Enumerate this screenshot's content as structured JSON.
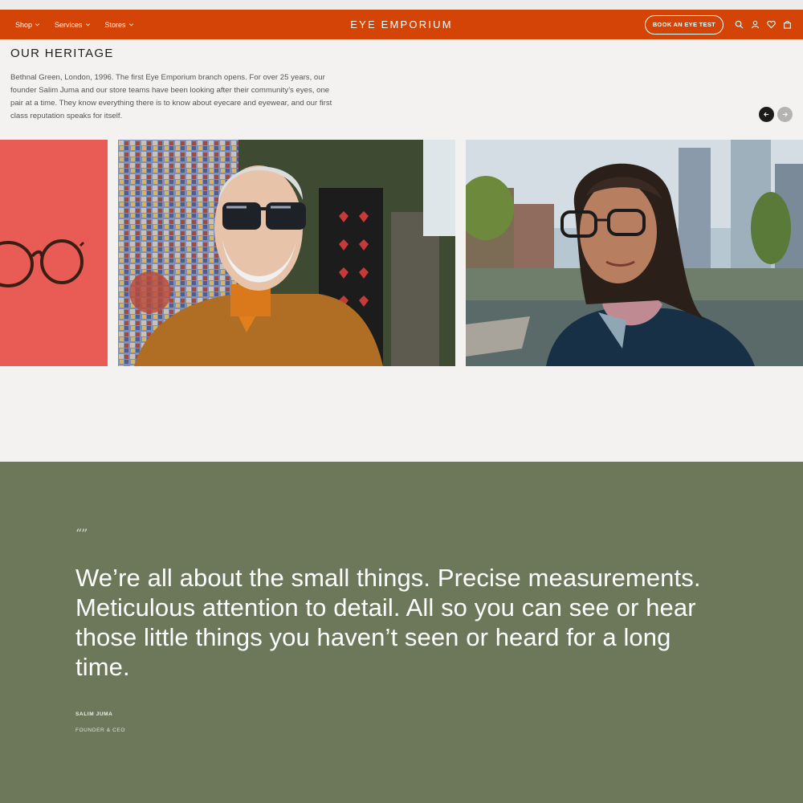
{
  "nav": {
    "items": [
      {
        "label": "Shop",
        "icon": "chevron-down-icon"
      },
      {
        "label": "Services",
        "icon": "chevron-down-icon"
      },
      {
        "label": "Stores",
        "icon": "chevron-down-icon"
      }
    ],
    "brand": "EYE EMPORIUM",
    "cta_label": "BOOK AN EYE TEST",
    "icons": [
      "search-icon",
      "account-icon",
      "wishlist-heart-icon",
      "bag-icon"
    ],
    "accent_color": "#d44406"
  },
  "heritage": {
    "title": "OUR HERITAGE",
    "body": "Bethnal Green, London, 1996. The first Eye Emporium branch opens. For over 25 years, our founder Salim Juma and our store teams have been looking after their community’s eyes, one pair at a time. They know everything there is to know about eyecare and eyewear, and our first class reputation speaks for itself.",
    "carousel_controls": [
      "arrow-left-icon",
      "arrow-right-icon"
    ]
  },
  "quote": {
    "mark": "“”",
    "text": "We’re all about the small things. Precise measurements. Meticulous attention to detail. All so you can see or hear those little things you haven’t seen or heard for a long time.",
    "author": "SALIM JUMA",
    "role": "FOUNDER & CEO",
    "background_color": "#6d775a"
  }
}
